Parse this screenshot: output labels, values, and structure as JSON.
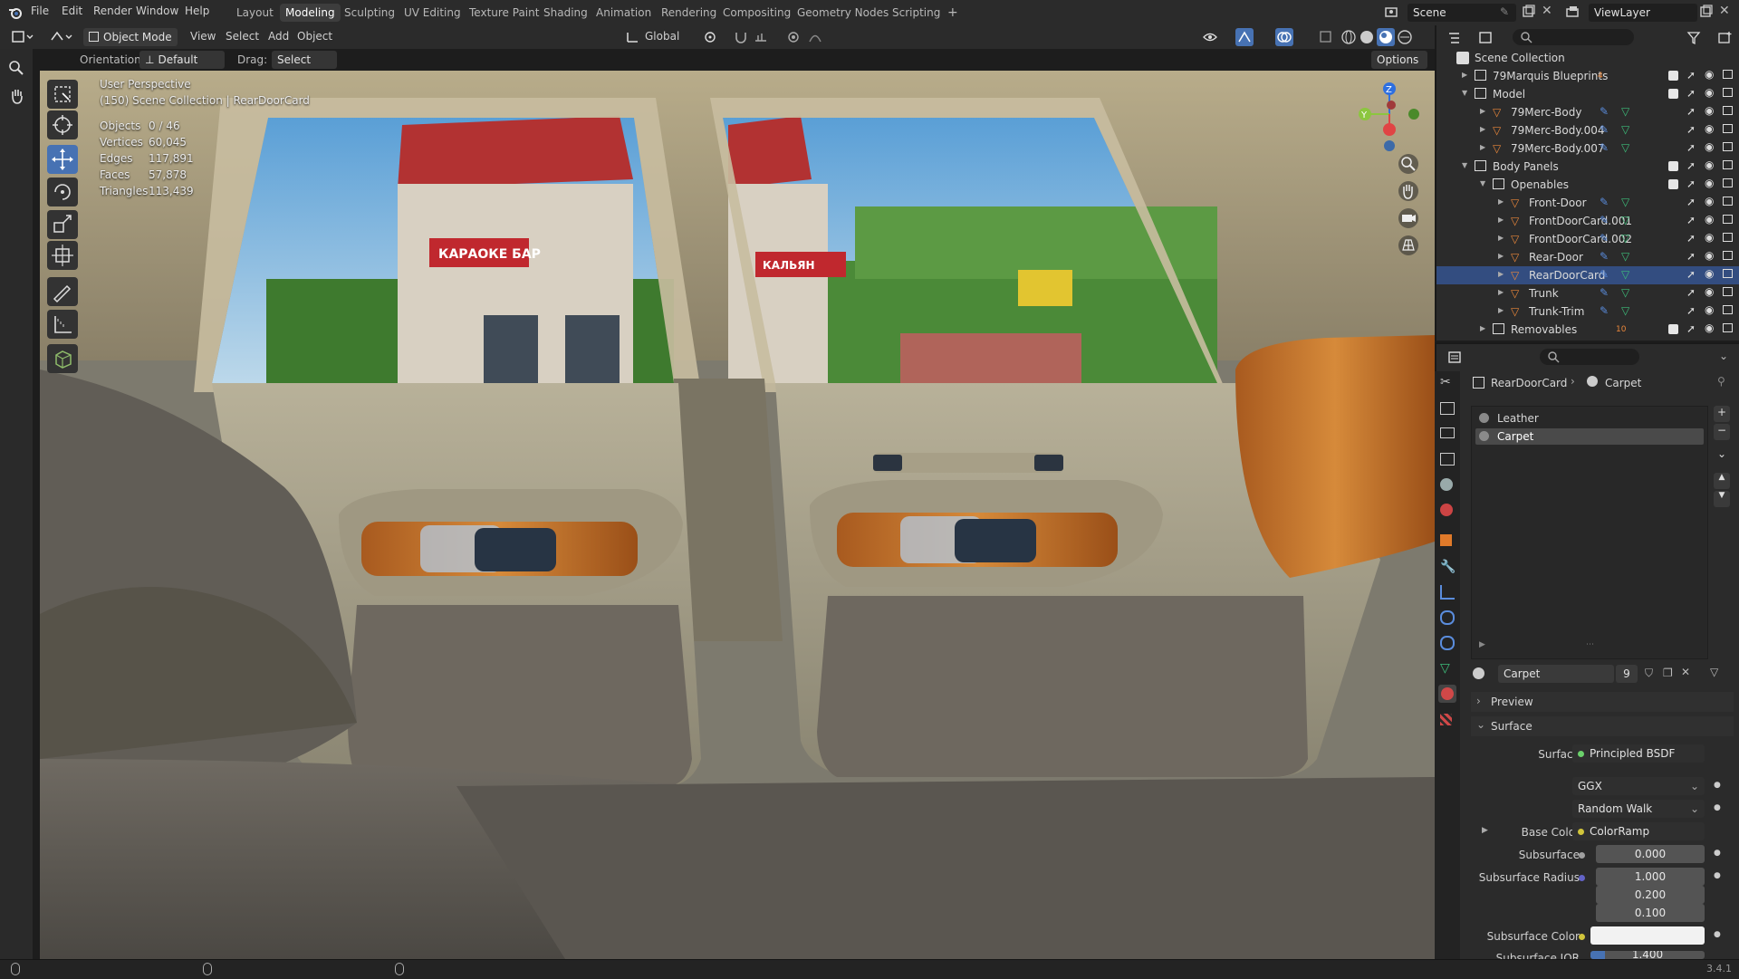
{
  "menu": {
    "items": [
      "File",
      "Edit",
      "Render",
      "Window",
      "Help"
    ],
    "workspaces": [
      "Layout",
      "Modeling",
      "Sculpting",
      "UV Editing",
      "Texture Paint",
      "Shading",
      "Animation",
      "Rendering",
      "Compositing",
      "Geometry Nodes",
      "Scripting"
    ],
    "active_workspace": "Modeling",
    "add_workspace": "+",
    "scene": "Scene",
    "view_layer": "ViewLayer"
  },
  "header": {
    "mode": "Object Mode",
    "view": "View",
    "select": "Select",
    "add": "Add",
    "object": "Object",
    "transform_orientation": "Global",
    "orientation_label": "Orientation:",
    "orientation_value": "Default",
    "drag_label": "Drag:",
    "drag_value": "Select Box",
    "options": "Options"
  },
  "viewport": {
    "perspective": "User Perspective",
    "collection": "(150) Scene Collection | RearDoorCard",
    "stats": [
      {
        "label": "Objects",
        "value": "0 / 46"
      },
      {
        "label": "Vertices",
        "value": "60,045"
      },
      {
        "label": "Edges",
        "value": "117,891"
      },
      {
        "label": "Faces",
        "value": "57,878"
      },
      {
        "label": "Triangles",
        "value": "113,439"
      }
    ],
    "sign_left": "КАРАОКЕ БАР",
    "sign_right": "КАЛЬЯН",
    "gizmo": {
      "x": "X",
      "y": "Y",
      "z": "Z"
    }
  },
  "outliner": {
    "root": "Scene Collection",
    "rows": [
      {
        "label": "79Marquis Blueprints",
        "indent": 1,
        "badge": "4"
      },
      {
        "label": "Model",
        "indent": 1
      },
      {
        "label": "79Merc-Body",
        "indent": 2
      },
      {
        "label": "79Merc-Body.004",
        "indent": 2
      },
      {
        "label": "79Merc-Body.007",
        "indent": 2
      },
      {
        "label": "Body Panels",
        "indent": 1
      },
      {
        "label": "Openables",
        "indent": 2
      },
      {
        "label": "Front-Door",
        "indent": 3
      },
      {
        "label": "FrontDoorCard.001",
        "indent": 3
      },
      {
        "label": "FrontDoorCard.002",
        "indent": 3
      },
      {
        "label": "Rear-Door",
        "indent": 3
      },
      {
        "label": "RearDoorCard",
        "indent": 3
      },
      {
        "label": "Trunk",
        "indent": 3
      },
      {
        "label": "Trunk-Trim",
        "indent": 3
      },
      {
        "label": "Removables",
        "indent": 2,
        "badge": "10"
      }
    ]
  },
  "properties": {
    "breadcrumb_object": "RearDoorCard",
    "breadcrumb_material": "Carpet",
    "material_slots": [
      "Leather",
      "Carpet"
    ],
    "active_slot": "Carpet",
    "material_name": "Carpet",
    "users": "9",
    "preview": "Preview",
    "surface_panel": "Surface",
    "surface_label": "Surface",
    "surface_value": "Principled BSDF",
    "distribution": "GGX",
    "subsurface_method": "Random Walk",
    "base_color_label": "Base Color",
    "base_color_value": "ColorRamp",
    "subsurface_label": "Subsurface",
    "subsurface_value": "0.000",
    "subsurface_radius_label": "Subsurface Radius",
    "subsurface_radius": [
      "1.000",
      "0.200",
      "0.100"
    ],
    "subsurface_color_label": "Subsurface Color",
    "subsurface_ior_label": "Subsurface IOR",
    "subsurface_ior_value": "1.400"
  },
  "status": {
    "version": "3.4.1"
  },
  "colors": {
    "accent": "#4772b3",
    "selection": "#334d80",
    "panel": "#2b2b2b"
  }
}
